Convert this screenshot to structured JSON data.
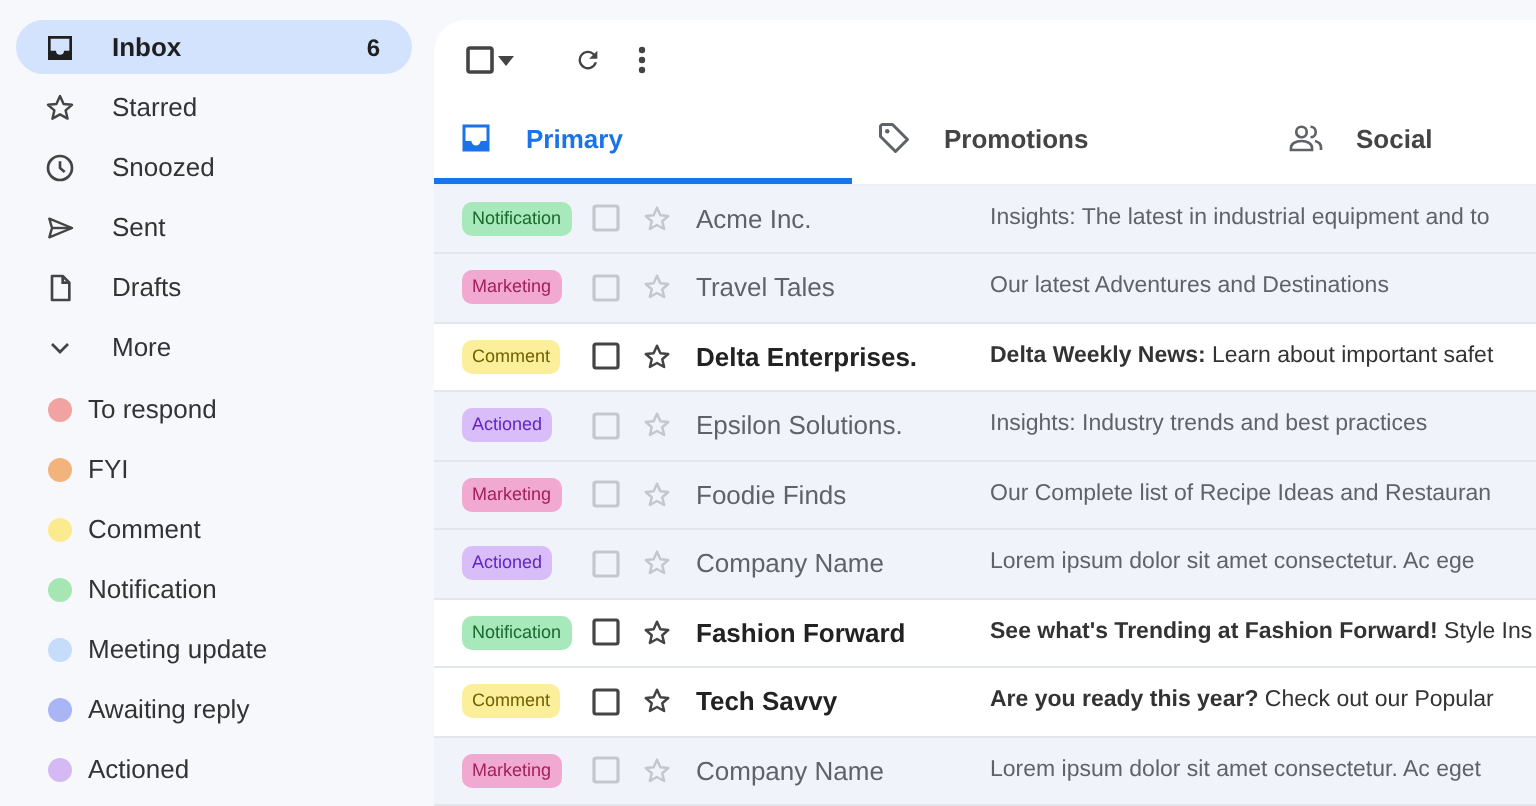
{
  "sidebar": {
    "items": [
      {
        "label": "Inbox",
        "count": "6",
        "selected": true
      },
      {
        "label": "Starred",
        "selected": false
      },
      {
        "label": "Snoozed",
        "selected": false
      },
      {
        "label": "Sent",
        "selected": false
      },
      {
        "label": "Drafts",
        "selected": false
      },
      {
        "label": "More",
        "selected": false
      }
    ],
    "labels": [
      {
        "label": "To respond",
        "color": "#f0a3a0"
      },
      {
        "label": "FYI",
        "color": "#f3b37c"
      },
      {
        "label": "Comment",
        "color": "#fcea8e"
      },
      {
        "label": "Notification",
        "color": "#a5e6b3"
      },
      {
        "label": "Meeting update",
        "color": "#c6dcfb"
      },
      {
        "label": "Awaiting reply",
        "color": "#a9b5f5"
      },
      {
        "label": "Actioned",
        "color": "#d5b9f5"
      }
    ]
  },
  "tabs": [
    {
      "label": "Primary",
      "selected": true
    },
    {
      "label": "Promotions",
      "selected": false
    },
    {
      "label": "Social",
      "selected": false
    }
  ],
  "messages": [
    {
      "tag": "Notification",
      "color": "#a8e9bb",
      "unread": false,
      "sender": "Acme Inc.",
      "preview": "Insights: The latest in industrial equipment and to"
    },
    {
      "tag": "Marketing",
      "color": "#f2a9d1",
      "unread": false,
      "sender": "Travel Tales",
      "preview": "Our latest Adventures and Destinations"
    },
    {
      "tag": "Comment",
      "color": "#fcef9c",
      "unread": true,
      "sender": "Delta Enterprises.",
      "preview": "**Delta Weekly News:** Learn about important safet"
    },
    {
      "tag": "Actioned",
      "color": "#d9bdf9",
      "unread": false,
      "sender": "Epsilon Solutions.",
      "preview": "Insights: Industry trends and best practices"
    },
    {
      "tag": "Marketing",
      "color": "#f2a9d1",
      "unread": false,
      "sender": "Foodie Finds",
      "preview": "Our Complete list of Recipe Ideas and Restauran"
    },
    {
      "tag": "Actioned",
      "color": "#d9bdf9",
      "unread": false,
      "sender": "Company Name",
      "preview": "Lorem ipsum dolor sit amet consectetur. Ac ege"
    },
    {
      "tag": "Notification",
      "color": "#a8e9bb",
      "unread": true,
      "sender": "Fashion Forward",
      "preview": "**See what's Trending at Fashion Forward!** Style Ins"
    },
    {
      "tag": "Comment",
      "color": "#fcef9c",
      "unread": true,
      "sender": "Tech Savvy",
      "preview": "**Are you ready this year?** Check out our Popular"
    },
    {
      "tag": "Marketing",
      "color": "#f2a9d1",
      "unread": false,
      "sender": "Company Name",
      "preview": "Lorem ipsum dolor sit amet consectetur. Ac eget"
    }
  ]
}
